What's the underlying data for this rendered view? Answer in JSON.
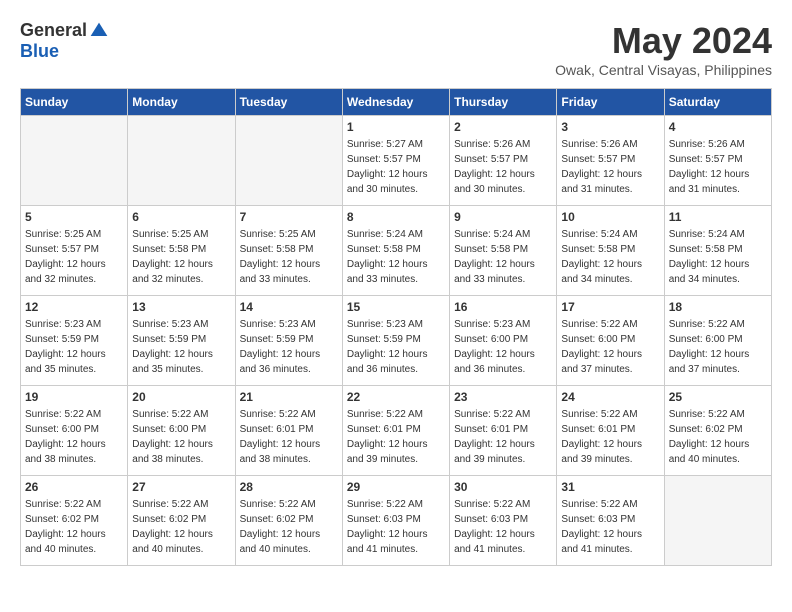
{
  "header": {
    "logo_general": "General",
    "logo_blue": "Blue",
    "title": "May 2024",
    "location": "Owak, Central Visayas, Philippines"
  },
  "days_of_week": [
    "Sunday",
    "Monday",
    "Tuesday",
    "Wednesday",
    "Thursday",
    "Friday",
    "Saturday"
  ],
  "weeks": [
    [
      {
        "day": "",
        "empty": true
      },
      {
        "day": "",
        "empty": true
      },
      {
        "day": "",
        "empty": true
      },
      {
        "day": "1",
        "sunrise": "5:27 AM",
        "sunset": "5:57 PM",
        "daylight": "12 hours and 30 minutes."
      },
      {
        "day": "2",
        "sunrise": "5:26 AM",
        "sunset": "5:57 PM",
        "daylight": "12 hours and 30 minutes."
      },
      {
        "day": "3",
        "sunrise": "5:26 AM",
        "sunset": "5:57 PM",
        "daylight": "12 hours and 31 minutes."
      },
      {
        "day": "4",
        "sunrise": "5:26 AM",
        "sunset": "5:57 PM",
        "daylight": "12 hours and 31 minutes."
      }
    ],
    [
      {
        "day": "5",
        "sunrise": "5:25 AM",
        "sunset": "5:57 PM",
        "daylight": "12 hours and 32 minutes."
      },
      {
        "day": "6",
        "sunrise": "5:25 AM",
        "sunset": "5:58 PM",
        "daylight": "12 hours and 32 minutes."
      },
      {
        "day": "7",
        "sunrise": "5:25 AM",
        "sunset": "5:58 PM",
        "daylight": "12 hours and 33 minutes."
      },
      {
        "day": "8",
        "sunrise": "5:24 AM",
        "sunset": "5:58 PM",
        "daylight": "12 hours and 33 minutes."
      },
      {
        "day": "9",
        "sunrise": "5:24 AM",
        "sunset": "5:58 PM",
        "daylight": "12 hours and 33 minutes."
      },
      {
        "day": "10",
        "sunrise": "5:24 AM",
        "sunset": "5:58 PM",
        "daylight": "12 hours and 34 minutes."
      },
      {
        "day": "11",
        "sunrise": "5:24 AM",
        "sunset": "5:58 PM",
        "daylight": "12 hours and 34 minutes."
      }
    ],
    [
      {
        "day": "12",
        "sunrise": "5:23 AM",
        "sunset": "5:59 PM",
        "daylight": "12 hours and 35 minutes."
      },
      {
        "day": "13",
        "sunrise": "5:23 AM",
        "sunset": "5:59 PM",
        "daylight": "12 hours and 35 minutes."
      },
      {
        "day": "14",
        "sunrise": "5:23 AM",
        "sunset": "5:59 PM",
        "daylight": "12 hours and 36 minutes."
      },
      {
        "day": "15",
        "sunrise": "5:23 AM",
        "sunset": "5:59 PM",
        "daylight": "12 hours and 36 minutes."
      },
      {
        "day": "16",
        "sunrise": "5:23 AM",
        "sunset": "6:00 PM",
        "daylight": "12 hours and 36 minutes."
      },
      {
        "day": "17",
        "sunrise": "5:22 AM",
        "sunset": "6:00 PM",
        "daylight": "12 hours and 37 minutes."
      },
      {
        "day": "18",
        "sunrise": "5:22 AM",
        "sunset": "6:00 PM",
        "daylight": "12 hours and 37 minutes."
      }
    ],
    [
      {
        "day": "19",
        "sunrise": "5:22 AM",
        "sunset": "6:00 PM",
        "daylight": "12 hours and 38 minutes."
      },
      {
        "day": "20",
        "sunrise": "5:22 AM",
        "sunset": "6:00 PM",
        "daylight": "12 hours and 38 minutes."
      },
      {
        "day": "21",
        "sunrise": "5:22 AM",
        "sunset": "6:01 PM",
        "daylight": "12 hours and 38 minutes."
      },
      {
        "day": "22",
        "sunrise": "5:22 AM",
        "sunset": "6:01 PM",
        "daylight": "12 hours and 39 minutes."
      },
      {
        "day": "23",
        "sunrise": "5:22 AM",
        "sunset": "6:01 PM",
        "daylight": "12 hours and 39 minutes."
      },
      {
        "day": "24",
        "sunrise": "5:22 AM",
        "sunset": "6:01 PM",
        "daylight": "12 hours and 39 minutes."
      },
      {
        "day": "25",
        "sunrise": "5:22 AM",
        "sunset": "6:02 PM",
        "daylight": "12 hours and 40 minutes."
      }
    ],
    [
      {
        "day": "26",
        "sunrise": "5:22 AM",
        "sunset": "6:02 PM",
        "daylight": "12 hours and 40 minutes."
      },
      {
        "day": "27",
        "sunrise": "5:22 AM",
        "sunset": "6:02 PM",
        "daylight": "12 hours and 40 minutes."
      },
      {
        "day": "28",
        "sunrise": "5:22 AM",
        "sunset": "6:02 PM",
        "daylight": "12 hours and 40 minutes."
      },
      {
        "day": "29",
        "sunrise": "5:22 AM",
        "sunset": "6:03 PM",
        "daylight": "12 hours and 41 minutes."
      },
      {
        "day": "30",
        "sunrise": "5:22 AM",
        "sunset": "6:03 PM",
        "daylight": "12 hours and 41 minutes."
      },
      {
        "day": "31",
        "sunrise": "5:22 AM",
        "sunset": "6:03 PM",
        "daylight": "12 hours and 41 minutes."
      },
      {
        "day": "",
        "empty": true
      }
    ]
  ],
  "labels": {
    "sunrise": "Sunrise:",
    "sunset": "Sunset:",
    "daylight": "Daylight:"
  }
}
